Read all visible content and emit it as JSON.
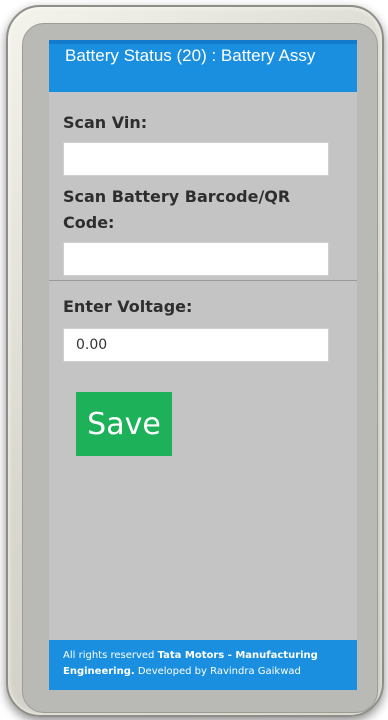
{
  "header": {
    "title": "Battery Status (20) : Battery Assy"
  },
  "form": {
    "vin_label": "Scan Vin:",
    "vin_value": "",
    "battery_label": "Scan Battery Barcode/QR Code:",
    "battery_value": "",
    "voltage_label": "Enter Voltage:",
    "voltage_value": "0.00"
  },
  "actions": {
    "save_label": "Save"
  },
  "footer": {
    "prefix": "All rights reserved ",
    "company": "Tata Motors - Manufacturing Engineering.",
    "suffix": " Developed by Ravindra Gaikwad"
  },
  "colors": {
    "header_blue": "#1a8fdf",
    "save_green": "#1db25a",
    "screen_gray": "#c4c4c4"
  }
}
